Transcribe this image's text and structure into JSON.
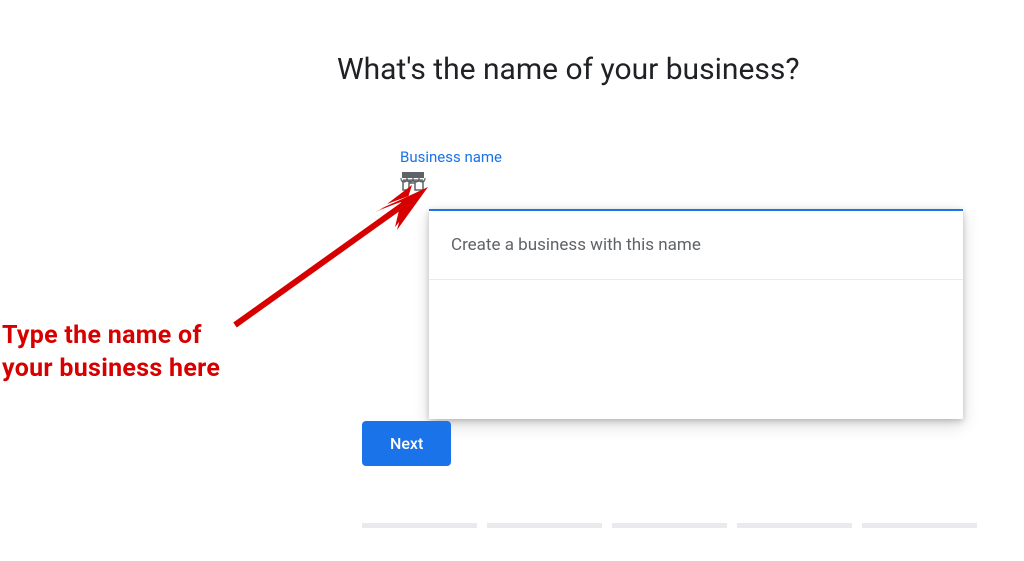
{
  "heading": "What's the name of your business?",
  "field": {
    "label": "Business name"
  },
  "dropdown": {
    "option": "Create a business with this name"
  },
  "buttons": {
    "next": "Next"
  },
  "annotation": {
    "line1": "Type the name of",
    "line2": "your business here"
  },
  "colors": {
    "accent": "#1a73e8",
    "text": "#202124",
    "muted": "#5f6368",
    "annotation": "#d60000"
  }
}
